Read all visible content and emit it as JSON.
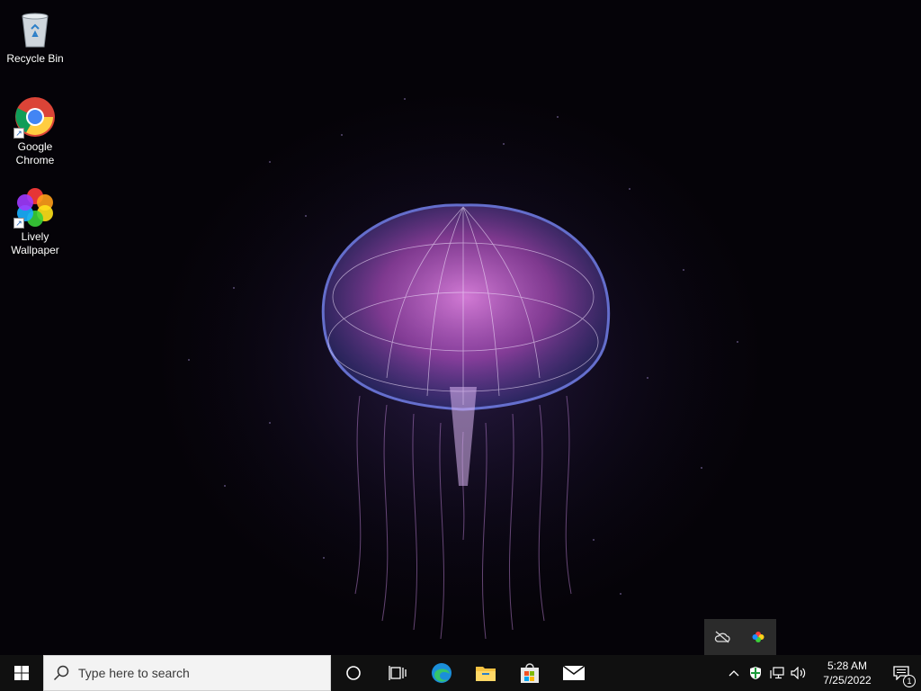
{
  "desktop": {
    "icons": [
      {
        "label": "Recycle Bin",
        "icon": "recycle-bin-icon"
      },
      {
        "label": "Google Chrome",
        "icon": "chrome-icon"
      },
      {
        "label": "Lively Wallpaper",
        "icon": "lively-wallpaper-icon"
      }
    ],
    "wallpaper": "jellyfish-animated-wallpaper"
  },
  "tray_popup": {
    "icons": [
      "cloud-offline-icon",
      "lively-tray-icon"
    ]
  },
  "taskbar": {
    "start": "windows-start-icon",
    "search_placeholder": "Type here to search",
    "apps": [
      "cortana-icon",
      "task-view-icon",
      "edge-icon",
      "file-explorer-icon",
      "microsoft-store-icon",
      "mail-icon"
    ],
    "tray_icons": [
      "chevron-up-icon",
      "windows-security-icon",
      "network-icon",
      "volume-icon"
    ],
    "time": "5:28 AM",
    "date": "7/25/2022",
    "notification_count": "1"
  },
  "colors": {
    "taskbar": "#101010",
    "search_bg": "#f3f3f3",
    "jellyfish_pink": "#d86ad8",
    "jellyfish_blue": "#5a6ad8"
  }
}
